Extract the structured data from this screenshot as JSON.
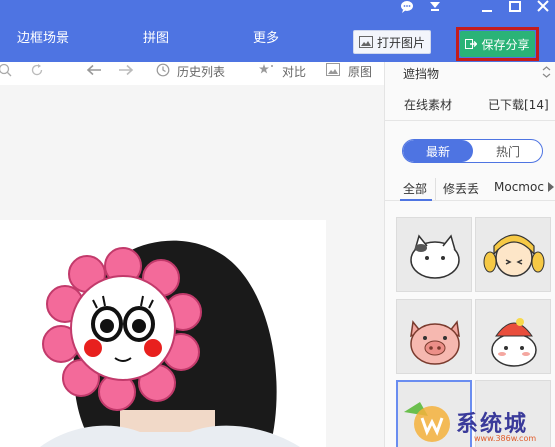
{
  "topbar": {
    "menu": [
      "边框场景",
      "拼图",
      "更多"
    ],
    "open_image": "打开图片",
    "save_share": "保存分享"
  },
  "toolbar": {
    "history": "历史列表",
    "compare": "对比",
    "original": "原图"
  },
  "panel": {
    "category_select": "遮挡物",
    "tabs": {
      "online": "在线素材",
      "downloaded": "已下载[14]"
    },
    "segment": {
      "latest": "最新",
      "hot": "热门"
    },
    "categories": [
      "全部",
      "修丢丢",
      "Mocmoc"
    ]
  },
  "watermark": {
    "brand": "系统城",
    "url": "www.386w.com"
  },
  "colors": {
    "topbar": "#4e74e2",
    "save_button": "#2ab377",
    "highlight": "#c41c1c",
    "accent": "#4e74e2"
  }
}
